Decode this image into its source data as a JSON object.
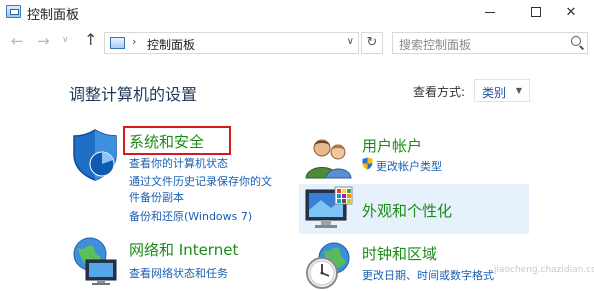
{
  "window": {
    "title": "控制面板"
  },
  "nav": {
    "back_glyph": "←",
    "forward_glyph": "→",
    "dropdown_glyph": "∨",
    "up_glyph": "↑"
  },
  "address": {
    "separator": "›",
    "path": "控制面板",
    "dropdown_glyph": "∨",
    "refresh_glyph": "↻"
  },
  "search": {
    "placeholder": "搜索控制面板"
  },
  "main": {
    "heading": "调整计算机的设置",
    "view_by_label": "查看方式:",
    "view_by_value": "类别",
    "view_by_arrow": "▼"
  },
  "categories": [
    {
      "title": "系统和安全",
      "links": [
        "查看你的计算机状态",
        "通过文件历史记录保存你的文",
        "件备份副本",
        "备份和还原(Windows 7)"
      ]
    },
    {
      "title": "用户帐户",
      "links": [
        "更改帐户类型"
      ]
    },
    {
      "title": "外观和个性化",
      "links": []
    },
    {
      "title": "网络和 Internet",
      "links": [
        "查看网络状态和任务"
      ]
    },
    {
      "title": "时钟和区域",
      "links": [
        "更改日期、时间或数字格式"
      ]
    }
  ],
  "watermark": "jiaocheng.chazidian.com"
}
